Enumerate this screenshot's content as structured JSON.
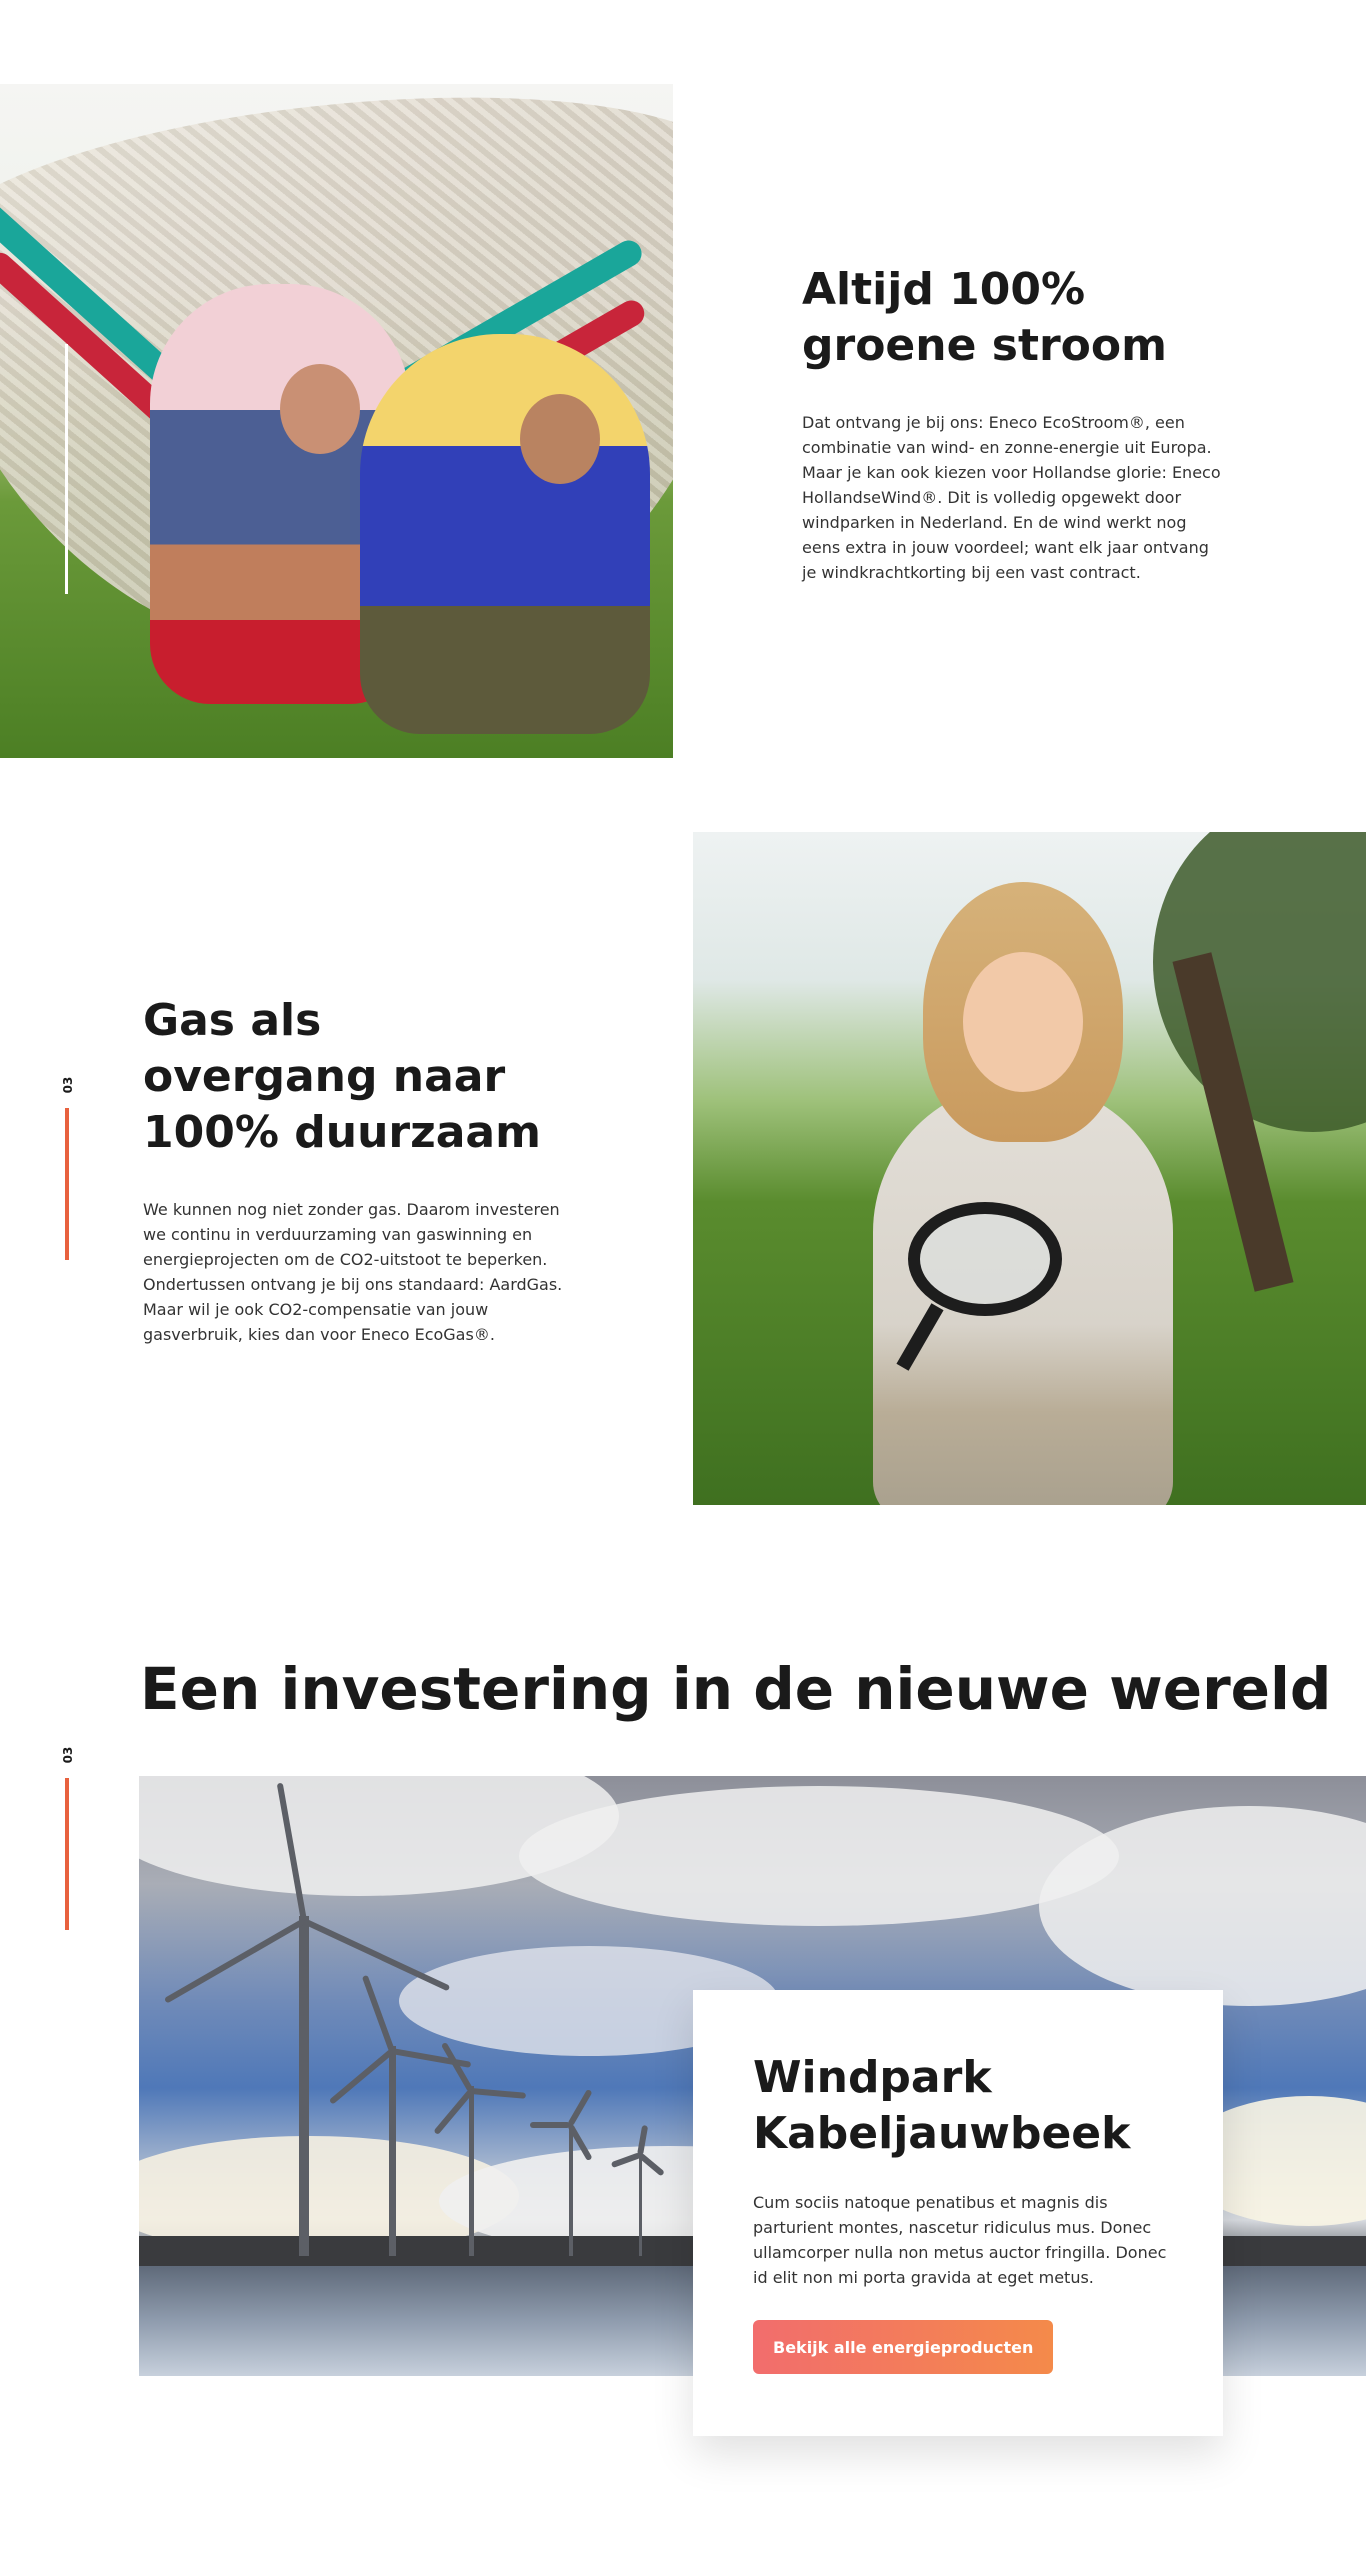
{
  "section1": {
    "image_alt": "Twee kinderen in een hangmat",
    "title": "Altijd 100% groene stroom",
    "body": "Dat ontvang je bij ons: Eneco EcoStroom®, een combinatie van wind- en zonne-energie uit Europa. Maar je kan ook kiezen voor Hollandse glorie: Eneco HollandseWind®. Dit is volledig opgewekt door windparken in Nederland. En de wind werkt nog eens extra in jouw voordeel; want elk jaar ontvang je windkrachtkorting bij een vast contract."
  },
  "section2": {
    "side_label": "03",
    "title": "Gas als overgang naar 100% duurzaam",
    "body": "We kunnen nog niet zonder gas. Daarom investeren we continu in verduurzaming van gaswinning en energieprojecten om de CO2-uitstoot te beperken. Ondertussen ontvang je bij ons standaard: AardGas. Maar wil je ook CO2-compensatie van jouw gasverbruik, kies dan voor Eneco EcoGas®."
  },
  "section3": {
    "side_label": "03",
    "title": "Een investering in de nieuwe wereld",
    "card": {
      "title": "Windpark Kabeljauwbeek",
      "body": "Cum sociis natoque penatibus et magnis dis parturient montes, nascetur ridiculus mus. Donec ullamcorper nulla non metus auctor fringilla. Donec id elit non mi porta gravida at eget metus.",
      "cta_label": "Bekijk alle energieproducten"
    }
  },
  "colors": {
    "accent": "#e8613e",
    "cta_start": "#f26d6d",
    "cta_end": "#f48a4a",
    "text": "#1a1a1a"
  }
}
